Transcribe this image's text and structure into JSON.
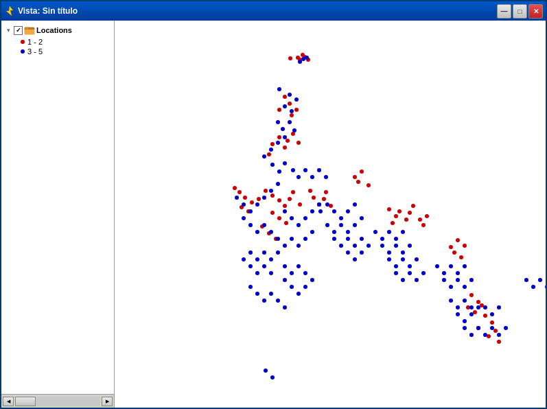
{
  "window": {
    "title": "Vista: Sin título",
    "icon": "map-icon"
  },
  "titlebar": {
    "minimize_label": "—",
    "maximize_label": "□",
    "close_label": "✕"
  },
  "sidebar": {
    "layer_name": "Locations",
    "expand_symbol": "▾",
    "legend": [
      {
        "id": "legend-1-2",
        "label": "1 - 2",
        "color": "#cc0000"
      },
      {
        "id": "legend-3-5",
        "label": "3 - 5",
        "color": "#0000cc"
      }
    ]
  },
  "dots": {
    "red": [
      [
        267,
        54
      ],
      [
        277,
        53
      ],
      [
        270,
        57
      ],
      [
        282,
        57
      ],
      [
        256,
        55
      ],
      [
        274,
        50
      ],
      [
        248,
        111
      ],
      [
        255,
        121
      ],
      [
        240,
        130
      ],
      [
        258,
        138
      ],
      [
        265,
        130
      ],
      [
        225,
        195
      ],
      [
        230,
        180
      ],
      [
        240,
        170
      ],
      [
        248,
        185
      ],
      [
        252,
        175
      ],
      [
        260,
        165
      ],
      [
        268,
        178
      ],
      [
        175,
        244
      ],
      [
        182,
        250
      ],
      [
        190,
        258
      ],
      [
        200,
        265
      ],
      [
        185,
        272
      ],
      [
        195,
        278
      ],
      [
        210,
        260
      ],
      [
        220,
        248
      ],
      [
        230,
        255
      ],
      [
        240,
        262
      ],
      [
        248,
        270
      ],
      [
        255,
        260
      ],
      [
        260,
        250
      ],
      [
        270,
        268
      ],
      [
        230,
        280
      ],
      [
        240,
        288
      ],
      [
        250,
        295
      ],
      [
        215,
        300
      ],
      [
        225,
        310
      ],
      [
        235,
        318
      ],
      [
        285,
        248
      ],
      [
        290,
        258
      ],
      [
        298,
        268
      ],
      [
        305,
        260
      ],
      [
        315,
        270
      ],
      [
        308,
        250
      ],
      [
        350,
        228
      ],
      [
        360,
        220
      ],
      [
        355,
        235
      ],
      [
        370,
        240
      ],
      [
        400,
        275
      ],
      [
        410,
        285
      ],
      [
        405,
        295
      ],
      [
        415,
        278
      ],
      [
        430,
        280
      ],
      [
        425,
        290
      ],
      [
        435,
        270
      ],
      [
        445,
        290
      ],
      [
        455,
        285
      ],
      [
        450,
        298
      ],
      [
        490,
        330
      ],
      [
        500,
        320
      ],
      [
        510,
        328
      ],
      [
        495,
        338
      ],
      [
        505,
        345
      ],
      [
        520,
        400
      ],
      [
        530,
        410
      ],
      [
        515,
        418
      ],
      [
        525,
        425
      ],
      [
        535,
        415
      ],
      [
        540,
        430
      ],
      [
        550,
        440
      ],
      [
        530,
        448
      ],
      [
        545,
        460
      ],
      [
        555,
        452
      ],
      [
        560,
        468
      ],
      [
        680,
        385
      ],
      [
        688,
        375
      ],
      [
        692,
        395
      ],
      [
        575,
        570
      ],
      [
        585,
        580
      ],
      [
        595,
        572
      ]
    ],
    "blue": [
      [
        275,
        56
      ],
      [
        280,
        54
      ],
      [
        270,
        60
      ],
      [
        240,
        100
      ],
      [
        255,
        108
      ],
      [
        265,
        115
      ],
      [
        248,
        125
      ],
      [
        258,
        132
      ],
      [
        238,
        148
      ],
      [
        245,
        158
      ],
      [
        255,
        148
      ],
      [
        262,
        160
      ],
      [
        248,
        170
      ],
      [
        238,
        178
      ],
      [
        228,
        188
      ],
      [
        218,
        198
      ],
      [
        230,
        210
      ],
      [
        240,
        220
      ],
      [
        248,
        208
      ],
      [
        260,
        218
      ],
      [
        268,
        228
      ],
      [
        278,
        218
      ],
      [
        288,
        228
      ],
      [
        298,
        218
      ],
      [
        308,
        228
      ],
      [
        178,
        258
      ],
      [
        188,
        268
      ],
      [
        198,
        278
      ],
      [
        208,
        268
      ],
      [
        218,
        258
      ],
      [
        228,
        248
      ],
      [
        238,
        238
      ],
      [
        248,
        278
      ],
      [
        258,
        288
      ],
      [
        268,
        298
      ],
      [
        278,
        288
      ],
      [
        288,
        278
      ],
      [
        298,
        268
      ],
      [
        188,
        288
      ],
      [
        198,
        298
      ],
      [
        208,
        308
      ],
      [
        218,
        298
      ],
      [
        228,
        308
      ],
      [
        238,
        318
      ],
      [
        248,
        328
      ],
      [
        258,
        318
      ],
      [
        268,
        328
      ],
      [
        278,
        318
      ],
      [
        288,
        308
      ],
      [
        198,
        338
      ],
      [
        208,
        348
      ],
      [
        218,
        338
      ],
      [
        228,
        348
      ],
      [
        238,
        338
      ],
      [
        248,
        358
      ],
      [
        258,
        368
      ],
      [
        268,
        358
      ],
      [
        278,
        368
      ],
      [
        188,
        348
      ],
      [
        198,
        358
      ],
      [
        208,
        368
      ],
      [
        218,
        358
      ],
      [
        228,
        368
      ],
      [
        248,
        378
      ],
      [
        258,
        388
      ],
      [
        268,
        398
      ],
      [
        278,
        388
      ],
      [
        288,
        378
      ],
      [
        198,
        388
      ],
      [
        208,
        398
      ],
      [
        218,
        408
      ],
      [
        228,
        398
      ],
      [
        238,
        408
      ],
      [
        248,
        418
      ],
      [
        300,
        278
      ],
      [
        310,
        268
      ],
      [
        320,
        278
      ],
      [
        330,
        288
      ],
      [
        340,
        278
      ],
      [
        350,
        268
      ],
      [
        310,
        298
      ],
      [
        320,
        308
      ],
      [
        330,
        298
      ],
      [
        340,
        308
      ],
      [
        350,
        298
      ],
      [
        360,
        288
      ],
      [
        320,
        318
      ],
      [
        330,
        328
      ],
      [
        340,
        318
      ],
      [
        350,
        328
      ],
      [
        360,
        318
      ],
      [
        340,
        338
      ],
      [
        350,
        348
      ],
      [
        360,
        338
      ],
      [
        370,
        328
      ],
      [
        380,
        308
      ],
      [
        390,
        318
      ],
      [
        400,
        308
      ],
      [
        410,
        318
      ],
      [
        420,
        308
      ],
      [
        390,
        328
      ],
      [
        400,
        338
      ],
      [
        410,
        328
      ],
      [
        420,
        338
      ],
      [
        430,
        328
      ],
      [
        400,
        348
      ],
      [
        410,
        358
      ],
      [
        420,
        348
      ],
      [
        430,
        358
      ],
      [
        440,
        348
      ],
      [
        410,
        368
      ],
      [
        420,
        378
      ],
      [
        430,
        368
      ],
      [
        440,
        378
      ],
      [
        450,
        368
      ],
      [
        470,
        358
      ],
      [
        480,
        368
      ],
      [
        490,
        358
      ],
      [
        500,
        368
      ],
      [
        510,
        358
      ],
      [
        480,
        378
      ],
      [
        490,
        388
      ],
      [
        500,
        378
      ],
      [
        510,
        388
      ],
      [
        520,
        378
      ],
      [
        490,
        408
      ],
      [
        500,
        418
      ],
      [
        510,
        408
      ],
      [
        520,
        418
      ],
      [
        500,
        428
      ],
      [
        510,
        438
      ],
      [
        520,
        428
      ],
      [
        530,
        418
      ],
      [
        510,
        448
      ],
      [
        520,
        458
      ],
      [
        530,
        448
      ],
      [
        540,
        458
      ],
      [
        540,
        418
      ],
      [
        550,
        428
      ],
      [
        560,
        418
      ],
      [
        550,
        448
      ],
      [
        560,
        458
      ],
      [
        570,
        448
      ],
      [
        600,
        378
      ],
      [
        610,
        388
      ],
      [
        620,
        378
      ],
      [
        630,
        388
      ],
      [
        640,
        378
      ],
      [
        640,
        398
      ],
      [
        650,
        408
      ],
      [
        660,
        398
      ],
      [
        670,
        388
      ],
      [
        660,
        378
      ],
      [
        670,
        368
      ],
      [
        220,
        510
      ],
      [
        230,
        520
      ]
    ]
  }
}
